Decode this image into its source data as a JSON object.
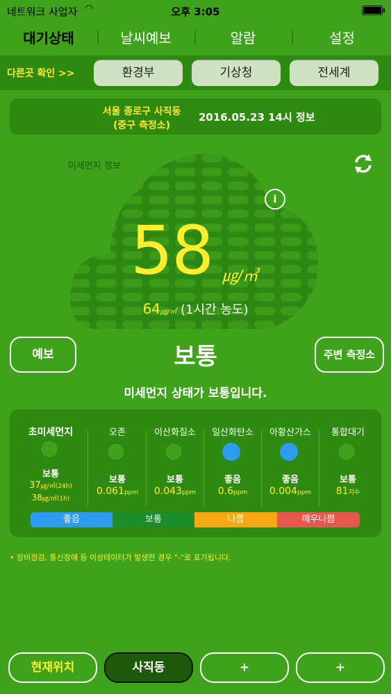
{
  "status_bar": {
    "carrier": "네트워크 사업자",
    "time": "오후 3:05"
  },
  "tabs": [
    {
      "label": "대기상태",
      "active": true
    },
    {
      "label": "날씨예보",
      "active": false
    },
    {
      "label": "알람",
      "active": false
    },
    {
      "label": "설정",
      "active": false
    }
  ],
  "subbar": {
    "other_label": "다른곳 확인 >>",
    "buttons": [
      "환경부",
      "기상청",
      "전세계"
    ]
  },
  "location": {
    "line1": "서울 종로구 사직동",
    "line2": "(중구 측정소)",
    "datetime": "2016.05.23 14시 정보"
  },
  "main": {
    "label": "미세먼지 정보",
    "value": "58",
    "unit": "㎍/㎥",
    "hour_value": "64",
    "hour_unit": "㎍/㎥",
    "hour_text": "(1시간 농도)",
    "grade": "보통",
    "message": "미세먼지 상태가 보통입니다.",
    "forecast_button": "예보",
    "nearby_button": "주변 측정소"
  },
  "pollutants": [
    {
      "name": "초미세먼지",
      "grade": "보통",
      "color": "#3ea21a",
      "value": "37",
      "unit": "㎍/㎥(24h)",
      "value2": "38",
      "unit2": "㎍/㎥(1h)"
    },
    {
      "name": "오존",
      "grade": "보통",
      "color": "#3ea21a",
      "value": "0.061",
      "unit": "ppm"
    },
    {
      "name": "이산화질소",
      "grade": "보통",
      "color": "#3ea21a",
      "value": "0.043",
      "unit": "ppm"
    },
    {
      "name": "일산화탄소",
      "grade": "좋음",
      "color": "#2d9cf0",
      "value": "0.6",
      "unit": "ppm"
    },
    {
      "name": "아황산가스",
      "grade": "좋음",
      "color": "#2d9cf0",
      "value": "0.004",
      "unit": "ppm"
    },
    {
      "name": "통합대기",
      "grade": "보통",
      "color": "#3ea21a",
      "value": "81",
      "unit": "지수"
    }
  ],
  "legend": [
    {
      "label": "좋음",
      "color": "#2d9cf0"
    },
    {
      "label": "보통",
      "color": "#1b8e2b"
    },
    {
      "label": "나쁨",
      "color": "#f7a70f"
    },
    {
      "label": "매우나쁨",
      "color": "#e8574e"
    }
  ],
  "note": "• 장비점검, 통신장애 등 이상테이터가 발생한 경우 \"-\"로 표기됩니다.",
  "bottom": {
    "current": "현재위치",
    "saved": "사직동",
    "add1": "+",
    "add2": "+"
  },
  "colors": {
    "background": "#3ea21a",
    "panel": "#2f8a12",
    "accent_yellow": "#ffee2e"
  }
}
